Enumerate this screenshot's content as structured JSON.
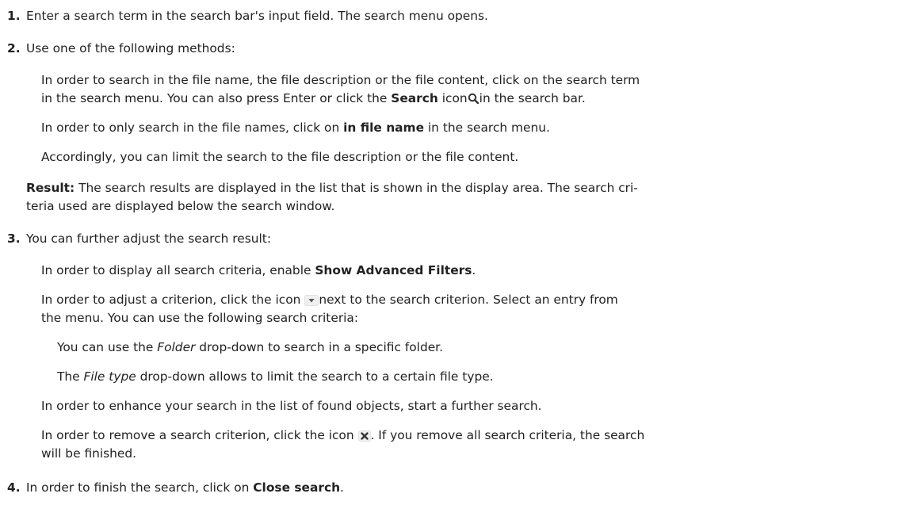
{
  "steps": [
    {
      "num": "1.",
      "text": "Enter a search term in the search bar's input field. The search menu opens."
    },
    {
      "num": "2.",
      "text": "Use one of the following methods:",
      "methods": {
        "a_l1": "In order to search in the file name, the file description or the file content, click on the search term",
        "a_l2_pre": "in the search menu. You can also press Enter or click the ",
        "a_l2_bold": "Search",
        "a_l2_mid": " icon",
        "a_l2_post": "in the search bar.",
        "b_pre": "In order to only search in the file names, click on ",
        "b_bold": "in file name",
        "b_post": " in the search menu.",
        "c": "Accordingly, you can limit the search to the file description or the file content."
      },
      "result": {
        "label": "Result:",
        "l1": " The search results are displayed in the list that is shown in the display area. The search cri-",
        "l2": "teria used are displayed below the search window."
      }
    },
    {
      "num": "3.",
      "text": "You can further adjust the search result:",
      "items": {
        "adv_pre": "In order to display all search criteria, enable ",
        "adv_bold": "Show Advanced Filters",
        "adv_post": ".",
        "adj_l1_pre": "In order to adjust a criterion, click the icon ",
        "adj_l1_post": "next to the search criterion. Select an entry from",
        "adj_l2": "the menu. You can use the following search criteria:",
        "folder_pre": "You can use the ",
        "folder_it": "Folder",
        "folder_post": " drop-down to search in a specific folder.",
        "ftype_pre": "The ",
        "ftype_it": "File type",
        "ftype_post": " drop-down allows to limit the search to a certain file type.",
        "enhance": "In order to enhance your search in the list of found objects, start a further search.",
        "remove_l1_pre": "In order to remove a search criterion, click the icon ",
        "remove_l1_post": ". If you remove all search criteria, the search",
        "remove_l2": "will be finished."
      }
    },
    {
      "num": "4.",
      "text_pre": "In order to finish the search, click on ",
      "text_bold": "Close search",
      "text_post": "."
    }
  ],
  "icons": [
    "search-icon",
    "dropdown-arrow-icon",
    "remove-x-icon"
  ]
}
